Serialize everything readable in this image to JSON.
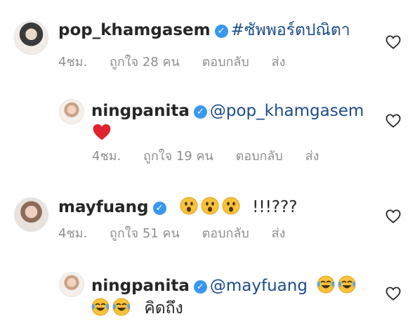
{
  "comments": [
    {
      "username": "pop_khamgasem",
      "text": "#ซัพพอร์ตปณิตา",
      "time": "4ชม.",
      "likes": "ถูกใจ 28 คน",
      "reply": "ตอบกลับ",
      "send": "ส่ง"
    },
    {
      "username": "ningpanita",
      "mention": "@pop_khamgasem",
      "time": "4ชม.",
      "likes": "ถูกใจ 19 คน",
      "reply": "ตอบกลับ",
      "send": "ส่ง"
    },
    {
      "username": "mayfuang",
      "text": "!!!???",
      "time": "4ชม.",
      "likes": "ถูกใจ 51 คน",
      "reply": "ตอบกลับ",
      "send": "ส่ง"
    },
    {
      "username": "ningpanita",
      "mention": "@mayfuang",
      "text2": "คิดถึง"
    }
  ],
  "icons": {
    "verified": "verified-badge-icon",
    "like": "heart-outline-icon",
    "red_heart": "red-heart-emoji",
    "surprised": "surprised-face-emoji",
    "laughing": "tears-of-joy-emoji"
  },
  "colors": {
    "verified": "#3897f0",
    "mention": "#1b4d8a",
    "meta": "#8e8e8e"
  }
}
